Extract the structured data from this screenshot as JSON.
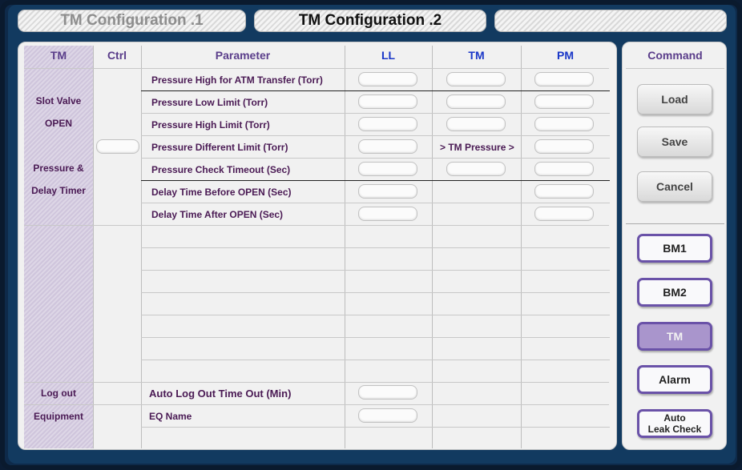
{
  "tabs": [
    {
      "label": "TM Configuration .1"
    },
    {
      "label": "TM Configuration .2"
    },
    {
      "label": ""
    }
  ],
  "headers": {
    "tm": "TM",
    "ctrl": "Ctrl",
    "parameter": "Parameter",
    "ll": "LL",
    "tm_col": "TM",
    "pm": "PM"
  },
  "tm_column": {
    "slot_valve": "Slot Valve",
    "open": "OPEN",
    "pressure": "Pressure &",
    "delay_timer": "Delay Timer",
    "log_out": "Log out",
    "equipment": "Equipment"
  },
  "parameters": [
    {
      "label": "Pressure High for ATM Transfer (Torr)"
    },
    {
      "label": "Pressure Low Limit (Torr)"
    },
    {
      "label": "Pressure High Limit (Torr)"
    },
    {
      "label": "Pressure Different Limit (Torr)"
    },
    {
      "label": "Pressure Check Timeout (Sec)"
    },
    {
      "label": "Delay Time Before OPEN (Sec)"
    },
    {
      "label": "Delay Time After OPEN (Sec)"
    }
  ],
  "tm_pressure_ref": ">  TM Pressure  >",
  "logout_param": "Auto Log Out Time Out (Min)",
  "eq_param": "EQ Name",
  "command": {
    "header": "Command",
    "load": "Load",
    "save": "Save",
    "cancel": "Cancel",
    "bm1": "BM1",
    "bm2": "BM2",
    "tm": "TM",
    "alarm": "Alarm",
    "auto_leak_1": "Auto",
    "auto_leak_2": "Leak Check"
  },
  "colors": {
    "accent_purple": "#6a52a8",
    "header_blue": "#1a37c8",
    "label_purple": "#4a1a54"
  }
}
